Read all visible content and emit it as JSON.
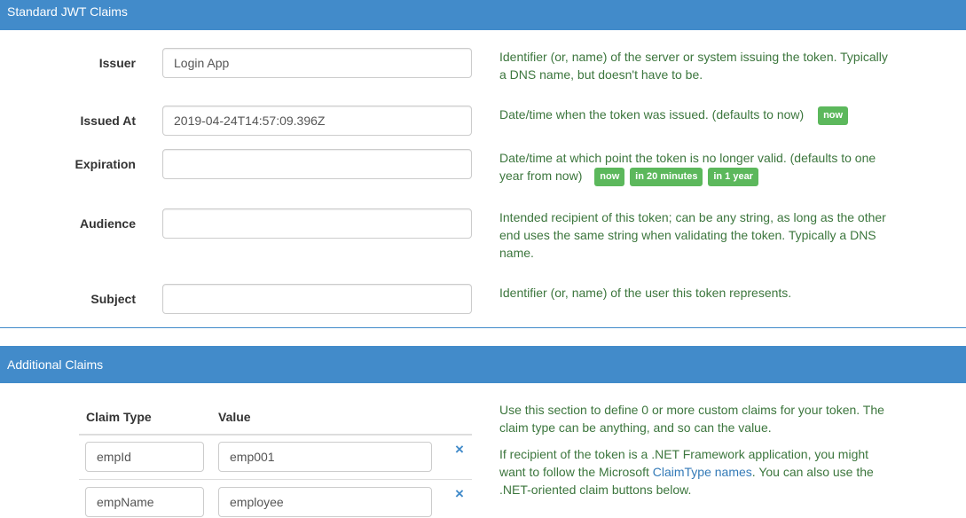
{
  "standard": {
    "heading": "Standard JWT Claims",
    "issuer": {
      "label": "Issuer",
      "value": "Login App",
      "help": "Identifier (or, name) of the server or system issuing the token. Typically a DNS name, but doesn't have to be."
    },
    "issued_at": {
      "label": "Issued At",
      "value": "2019-04-24T14:57:09.396Z",
      "help": "Date/time when the token was issued. (defaults to now)",
      "buttons": [
        "now"
      ]
    },
    "expiration": {
      "label": "Expiration",
      "value": "",
      "help": "Date/time at which point the token is no longer valid. (defaults to one year from now)",
      "buttons": [
        "now",
        "in 20 minutes",
        "in 1 year"
      ]
    },
    "audience": {
      "label": "Audience",
      "value": "",
      "help": "Intended recipient of this token; can be any string, as long as the other end uses the same string when validating the token. Typically a DNS name."
    },
    "subject": {
      "label": "Subject",
      "value": "",
      "help": "Identifier (or, name) of the user this token represents."
    }
  },
  "additional": {
    "heading": "Additional Claims",
    "columns": [
      "Claim Type",
      "Value"
    ],
    "rows": [
      {
        "type": "empId",
        "value": "emp001"
      },
      {
        "type": "empName",
        "value": "employee"
      }
    ],
    "help1": "Use this section to define 0 or more custom claims for your token. The claim type can be anything, and so can the value.",
    "help2_before": "If recipient of the token is a .NET Framework application, you might want to follow the Microsoft ",
    "help2_link": "ClaimType names",
    "help2_after": ". You can also use the .NET-oriented claim buttons below.",
    "delete_icon": "×"
  },
  "colors": {
    "header_bg": "#428bca",
    "help_text": "#3c763d",
    "badge": "#5cb85c",
    "link": "#337ab7"
  }
}
